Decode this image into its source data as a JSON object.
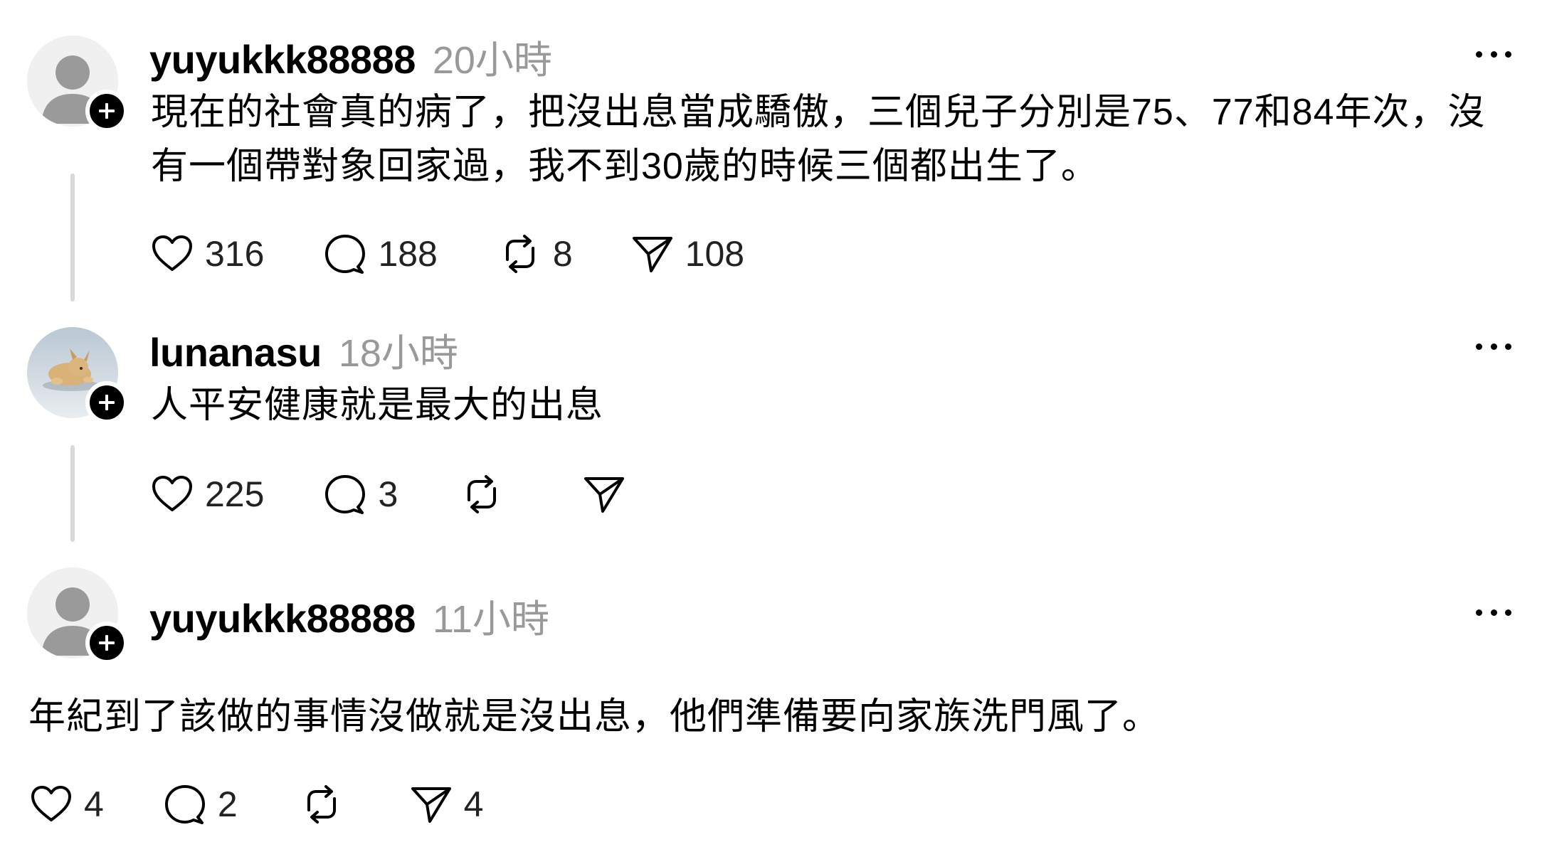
{
  "posts": [
    {
      "username": "yuyukkk88888",
      "timestamp": "20小時",
      "text_line1": "現在的社會真的病了，把沒出息當成驕傲，三個兒子分別是75、77和84年次，沒",
      "text_line2": "有一個帶對象回家過，我不到30歲的時候三個都出生了。",
      "likes": "316",
      "comments": "188",
      "reposts": "8",
      "shares": "108"
    },
    {
      "username": "lunanasu",
      "timestamp": "18小時",
      "text_line1": "人平安健康就是最大的出息",
      "likes": "225",
      "comments": "3"
    },
    {
      "username": "yuyukkk88888",
      "timestamp": "11小時",
      "text_line1": "年紀到了該做的事情沒做就是沒出息，他們準備要向家族洗門風了。",
      "likes": "4",
      "comments": "2",
      "shares": "4"
    }
  ],
  "icons": {
    "like": "heart-icon",
    "comment": "comment-icon",
    "repost": "repost-icon",
    "share": "share-icon",
    "more": "more-icon",
    "follow": "plus-icon",
    "avatar_default": "default-avatar-icon",
    "avatar_photo": "dog-photo-avatar"
  },
  "colors": {
    "text": "#000000",
    "muted": "#999999",
    "thread_line": "#d9d9d9",
    "badge": "#000000"
  }
}
